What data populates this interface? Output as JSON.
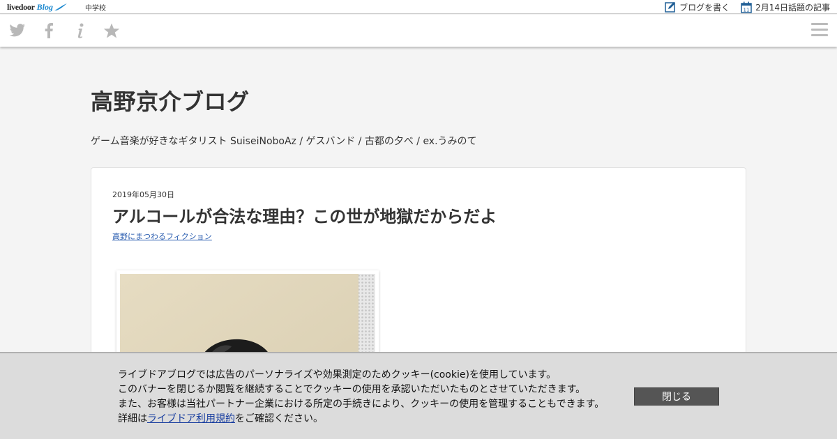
{
  "topbar": {
    "logo_livedoor": "livedoor",
    "logo_blog": "Blog",
    "category": "中学校",
    "write_blog": "ブログを書く",
    "calendar_day": "11",
    "trending": "2月14日話題の記事"
  },
  "sharebar": {
    "icons": [
      "twitter-icon",
      "facebook-icon",
      "info-icon",
      "star-icon",
      "menu-icon"
    ],
    "icon_color": "#b8b8b8"
  },
  "blog": {
    "title": "高野京介ブログ",
    "description": "ゲーム音楽が好きなギタリスト SuiseiNoboAz / ゲスバンド / 古都の夕べ / ex.うみのて"
  },
  "article": {
    "date": "2019年05月30日",
    "title": "アルコールが合法な理由？この世が地獄だからだよ",
    "category": "高野にまつわるフィクション"
  },
  "cookie": {
    "line1": "ライブドアブログでは広告のパーソナライズや効果測定のためクッキー(cookie)を使用しています。",
    "line2": "このバナーを閉じるか閲覧を継続することでクッキーの使用を承認いただいたものとさせていただきます。",
    "line3": "また、お客様は当社パートナー企業における所定の手続きにより、クッキーの使用を管理することもできます。",
    "line4_prefix": "詳細は",
    "line4_link": "ライブドア利用規約",
    "line4_suffix": "をご確認ください。",
    "close_label": "閉じる"
  },
  "colors": {
    "link": "#2a5db0",
    "accent_blue": "#1f8ad0",
    "close_button": "#555555",
    "banner_bg": "#dcdcdc"
  }
}
